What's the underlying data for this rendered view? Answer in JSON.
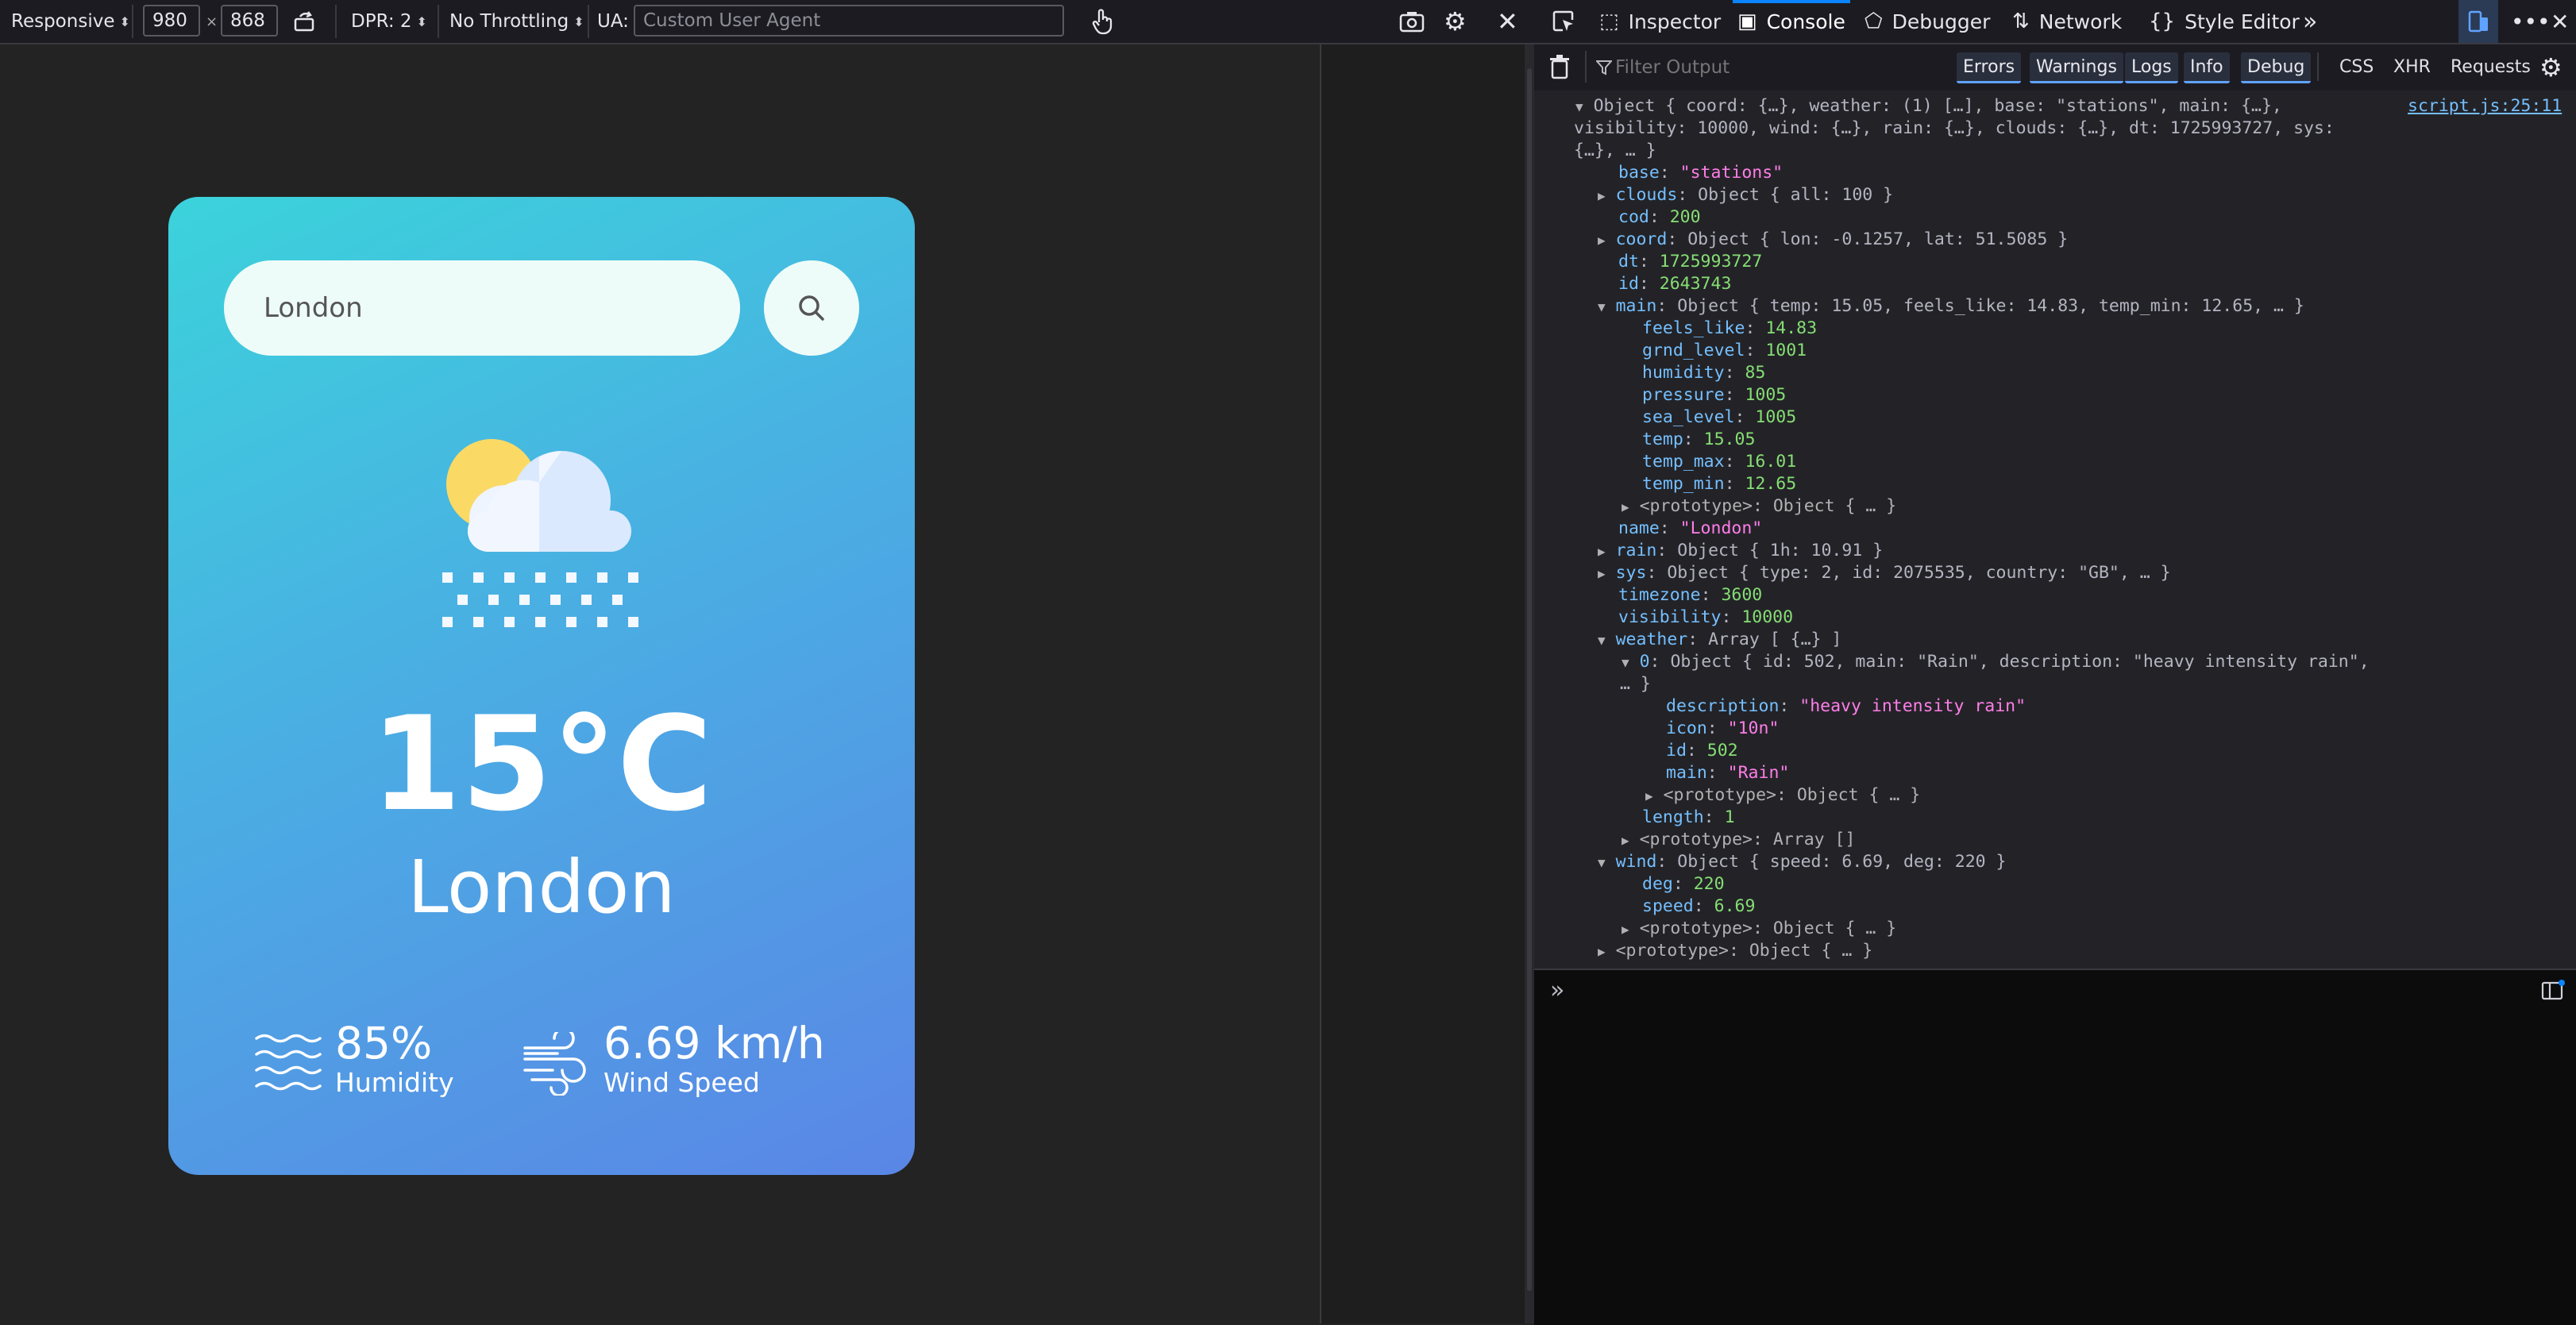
{
  "responsive_toolbar": {
    "device": "Responsive",
    "width": "980",
    "height": "868",
    "times": "×",
    "dpr": "DPR: 2",
    "throttling": "No Throttling",
    "ua_label": "UA:",
    "ua_placeholder": "Custom User Agent"
  },
  "devtools_tabs": [
    {
      "label": "Inspector"
    },
    {
      "label": "Console"
    },
    {
      "label": "Debugger"
    },
    {
      "label": "Network"
    },
    {
      "label": "Style Editor"
    }
  ],
  "console_toolbar": {
    "filter_placeholder": "Filter Output",
    "levels": [
      "Errors",
      "Warnings",
      "Logs",
      "Info",
      "Debug"
    ],
    "other": [
      "CSS",
      "XHR",
      "Requests"
    ]
  },
  "weather_card": {
    "search_value": "London",
    "temperature": "15°C",
    "city": "London",
    "humidity_value": "85%",
    "humidity_label": "Humidity",
    "wind_value": "6.69 km/h",
    "wind_label": "Wind Speed"
  },
  "console": {
    "source": "script.js:25:11",
    "lines": {
      "l1": "Object { coord: {…}, weather: (1) […], base: \"stations\", main: {…},",
      "l2": "visibility: 10000, wind: {…}, rain: {…}, clouds: {…}, dt: 1725993727, sys:",
      "l3": "{…}, … }",
      "base_k": "base",
      "base_v": "\"stations\"",
      "clouds_k": "clouds",
      "clouds_v": "Object { all: 100 }",
      "cod_k": "cod",
      "cod_v": "200",
      "coord_k": "coord",
      "coord_v": "Object { lon: -0.1257, lat: 51.5085 }",
      "dt_k": "dt",
      "dt_v": "1725993727",
      "id_k": "id",
      "id_v": "2643743",
      "main_k": "main",
      "main_v": "Object { temp: 15.05, feels_like: 14.83, temp_min: 12.65, … }",
      "feels_k": "feels_like",
      "feels_v": "14.83",
      "grnd_k": "grnd_level",
      "grnd_v": "1001",
      "hum_k": "humidity",
      "hum_v": "85",
      "pres_k": "pressure",
      "pres_v": "1005",
      "sea_k": "sea_level",
      "sea_v": "1005",
      "temp_k": "temp",
      "temp_v": "15.05",
      "tmax_k": "temp_max",
      "tmax_v": "16.01",
      "tmin_k": "temp_min",
      "tmin_v": "12.65",
      "proto_obj": "<prototype>: Object { … }",
      "name_k": "name",
      "name_v": "\"London\"",
      "rain_k": "rain",
      "rain_v": "Object { 1h: 10.91 }",
      "sys_k": "sys",
      "sys_v": "Object { type: 2, id: 2075535, country: \"GB\", … }",
      "tz_k": "timezone",
      "tz_v": "3600",
      "vis_k": "visibility",
      "vis_v": "10000",
      "weather_k": "weather",
      "weather_v": "Array [ {…} ]",
      "w0_k": "0",
      "w0_v": "Object { id: 502, main: \"Rain\", description: \"heavy intensity rain\",",
      "w0_v2": "… }",
      "desc_k": "description",
      "desc_v": "\"heavy intensity rain\"",
      "icon_k": "icon",
      "icon_v": "\"10n\"",
      "wid_k": "id",
      "wid_v": "502",
      "wmain_k": "main",
      "wmain_v": "\"Rain\"",
      "len_k": "length",
      "len_v": "1",
      "proto_arr": "<prototype>: Array []",
      "wind_k": "wind",
      "wind_v": "Object { speed: 6.69, deg: 220 }",
      "deg_k": "deg",
      "deg_v": "220",
      "speed_k": "speed",
      "speed_v": "6.69"
    }
  },
  "colors": {
    "card_gradient_start": "#3bd3db",
    "card_gradient_end": "#5a86e6",
    "console_key": "#75bfff",
    "console_string": "#ff7de9",
    "console_number": "#86de74"
  }
}
